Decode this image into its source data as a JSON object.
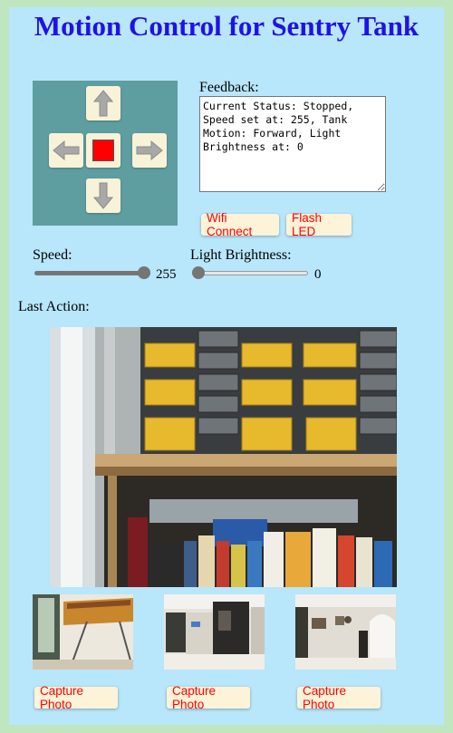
{
  "page": {
    "title": "Motion Control for Sentry Tank"
  },
  "dpad": {
    "up_icon": "arrow-up-icon",
    "down_icon": "arrow-down-icon",
    "left_icon": "arrow-left-icon",
    "right_icon": "arrow-right-icon",
    "stop_icon": "stop-icon"
  },
  "feedback": {
    "label": "Feedback:",
    "text": "Current Status: Stopped,\nSpeed set at: 255, Tank\nMotion: Forward, Light\nBrightness at: 0"
  },
  "buttons": {
    "wifi_connect": "Wifi Connect",
    "flash_led": "Flash LED"
  },
  "speed": {
    "label": "Speed:",
    "value": "255",
    "min": 0,
    "max": 255
  },
  "brightness": {
    "label": "Light Brightness:",
    "value": "0",
    "min": 0,
    "max": 255
  },
  "last_action": {
    "label": "Last Action:"
  },
  "thumbnails": [
    {
      "capture_label": "Capture Photo"
    },
    {
      "capture_label": "Capture Photo"
    },
    {
      "capture_label": "Capture Photo"
    }
  ],
  "colors": {
    "title": "#1f12e6",
    "panel_bg": "#b8e6fb",
    "page_border": "#bfe6bf",
    "dpad_bg": "#5f9ea0",
    "button_bg": "#fdf3d8",
    "button_text": "#ff0000",
    "stop": "#ff0000"
  }
}
